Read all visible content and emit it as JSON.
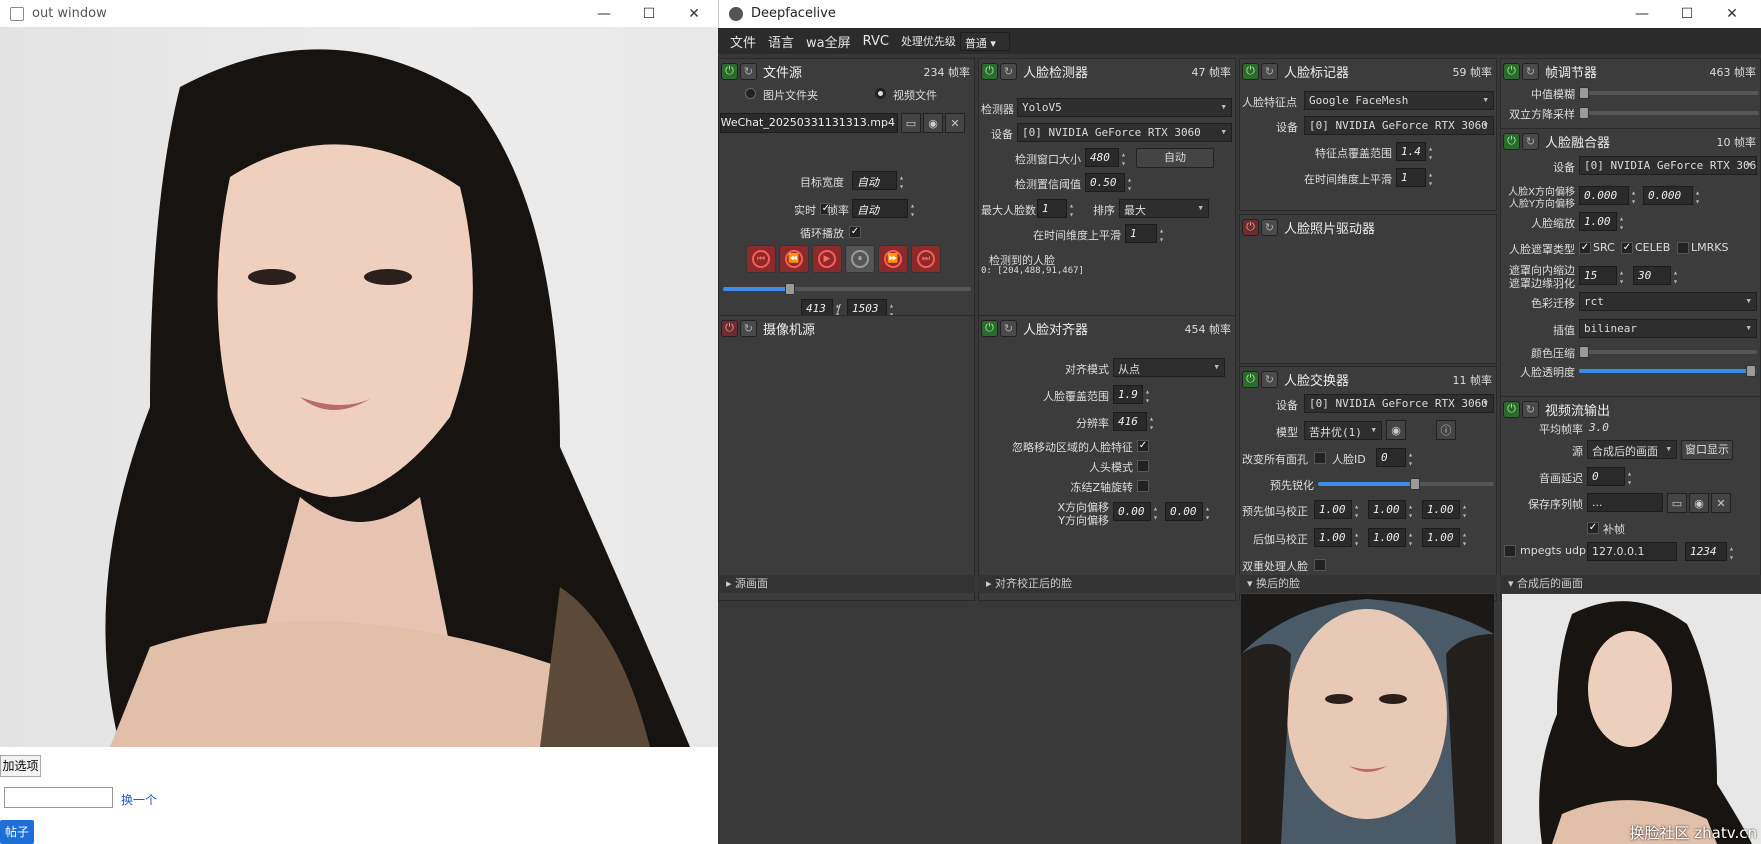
{
  "out_window": {
    "title": "out window",
    "btn_add": "加选项",
    "link_change": "换一个",
    "btn_post": "帖子"
  },
  "dfl": {
    "title": "Deepfacelive",
    "menu": [
      "文件",
      "语言",
      "wa全屏",
      "RVC",
      "处理优先级"
    ],
    "priority": "普通",
    "file_src": {
      "title": "文件源",
      "fps": "234 帧率",
      "opt_image": "图片文件夹",
      "opt_video": "视频文件",
      "path": "WeChat_20250331131313.mp4",
      "target_w_label": "目标宽度",
      "target_w": "自动",
      "realtime_label": "实时",
      "fps_label": "帧率",
      "fps_val": "自动",
      "loop_label": "循环播放",
      "frame": "413",
      "total": "1503",
      "progress": 0.27
    },
    "camera": {
      "title": "摄像机源"
    },
    "detector": {
      "title": "人脸检测器",
      "fps": "47 帧率",
      "det_label": "检测器",
      "det": "YoloV5",
      "dev_label": "设备",
      "dev": "[0] NVIDIA GeForce RTX 3060",
      "win_label": "检测窗口大小",
      "win": "480",
      "auto": "自动",
      "thr_label": "检测置信阈值",
      "thr": "0.50",
      "max_label": "最大人脸数",
      "max": "1",
      "sort_label": "排序",
      "sort": "最大",
      "smooth_label": "在时间维度上平滑",
      "smooth": "1",
      "found_label": "检测到的人脸",
      "found": "0: [204,488,91,467]"
    },
    "aligner": {
      "title": "人脸对齐器",
      "fps": "454 帧率",
      "mode_label": "对齐模式",
      "mode": "从点",
      "cov_label": "人脸覆盖范围",
      "cov": "1.9",
      "res_label": "分辨率",
      "res": "416",
      "ignore_label": "忽略移动区域的人脸特征",
      "head_label": "人头模式",
      "freeze_label": "冻结Z轴旋转",
      "xoff_label": "X方向偏移",
      "yoff_label": "Y方向偏移",
      "xoff": "0.00",
      "yoff": "0.00"
    },
    "marker": {
      "title": "人脸标记器",
      "fps": "59 帧率",
      "lm_label": "人脸特征点",
      "lm": "Google FaceMesh",
      "dev_label": "设备",
      "dev": "[0] NVIDIA GeForce RTX 3060",
      "range_label": "特征点覆盖范围",
      "range": "1.4",
      "smooth_label": "在时间维度上平滑",
      "smooth": "1"
    },
    "animator": {
      "title": "人脸照片驱动器"
    },
    "swapper": {
      "title": "人脸交换器",
      "fps": "11 帧率",
      "dev_label": "设备",
      "dev": "[0] NVIDIA GeForce RTX 3060",
      "model_label": "模型",
      "model": "苦井优(1)",
      "swap_all_label": "改变所有面孔",
      "id_label": "人脸ID",
      "id": "0",
      "sharpen_label": "预先锐化",
      "pre_gamma_label": "预先伽马校正",
      "post_gamma_label": "后伽马校正",
      "g": "1.00",
      "two_pass_label": "双重处理人脸"
    },
    "adjuster": {
      "title": "帧调节器",
      "fps": "463 帧率",
      "median_label": "中值模糊",
      "bilateral_label": "双立方降采样"
    },
    "merger": {
      "title": "人脸融合器",
      "fps": "10 帧率",
      "dev_label": "设备",
      "dev": "[0] NVIDIA GeForce RTX 3060",
      "xoff_label": "人脸X方向偏移",
      "yoff_label": "人脸Y方向偏移",
      "off": "0.000",
      "scale_label": "人脸缩放",
      "scale": "1.00",
      "mask_label": "人脸遮罩类型",
      "m_src": "SRC",
      "m_celeb": "CELEB",
      "m_lmrks": "LMRKS",
      "erode_label": "遮罩向内缩边",
      "blur_label": "遮罩边缘羽化",
      "erode": "15",
      "blur": "30",
      "color_label": "色彩迁移",
      "color": "rct",
      "interp_label": "插值",
      "interp": "bilinear",
      "compress_label": "颜色压缩",
      "opacity_label": "人脸透明度"
    },
    "stream": {
      "title": "视频流输出",
      "avg_label": "平均帧率",
      "avg": "3.0",
      "src_label": "源",
      "src": "合成后的画面",
      "window_btn": "窗口显示",
      "delay_label": "音画延迟",
      "delay": "0",
      "save_label": "保存序列帧",
      "save": "...",
      "fill_label": "补帧",
      "mpegts_label": "mpegts udp://",
      "ip": "127.0.0.1",
      "port": "1234"
    },
    "sections": {
      "source": "源画面",
      "aligned": "对齐校正后的脸",
      "swapped": "换后的脸",
      "merged": "合成后的画面"
    }
  },
  "watermark": "换脸社区 zhatv.cn"
}
